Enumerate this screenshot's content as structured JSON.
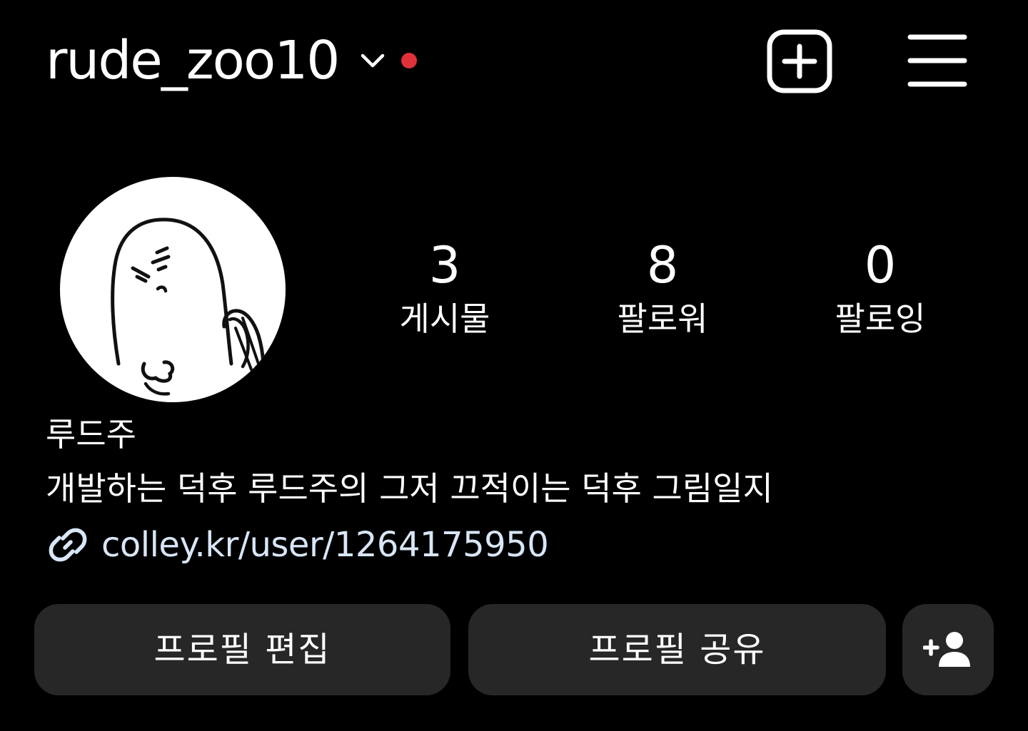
{
  "header": {
    "username": "rude_zoo10",
    "chevron_icon": "chevron-down-icon",
    "notification_dot_color": "#e0313a",
    "create_icon": "plus-square-icon",
    "menu_icon": "hamburger-menu-icon"
  },
  "profile": {
    "avatar_icon": "ghost-character-avatar",
    "stats": [
      {
        "value": "3",
        "label": "게시물"
      },
      {
        "value": "8",
        "label": "팔로워"
      },
      {
        "value": "0",
        "label": "팔로잉"
      }
    ]
  },
  "bio": {
    "display_name": "루드주",
    "text": "개발하는 덕후 루드주의 그저 끄적이는 덕후 그림일지",
    "link_icon": "link-icon",
    "link": "colley.kr/user/1264175950",
    "link_color": "#d8e6f7"
  },
  "actions": {
    "edit_label": "프로필 편집",
    "share_label": "프로필 공유",
    "discover_icon": "add-person-icon"
  },
  "colors": {
    "background": "#000000",
    "button_bg": "#272727",
    "text": "#ffffff"
  }
}
